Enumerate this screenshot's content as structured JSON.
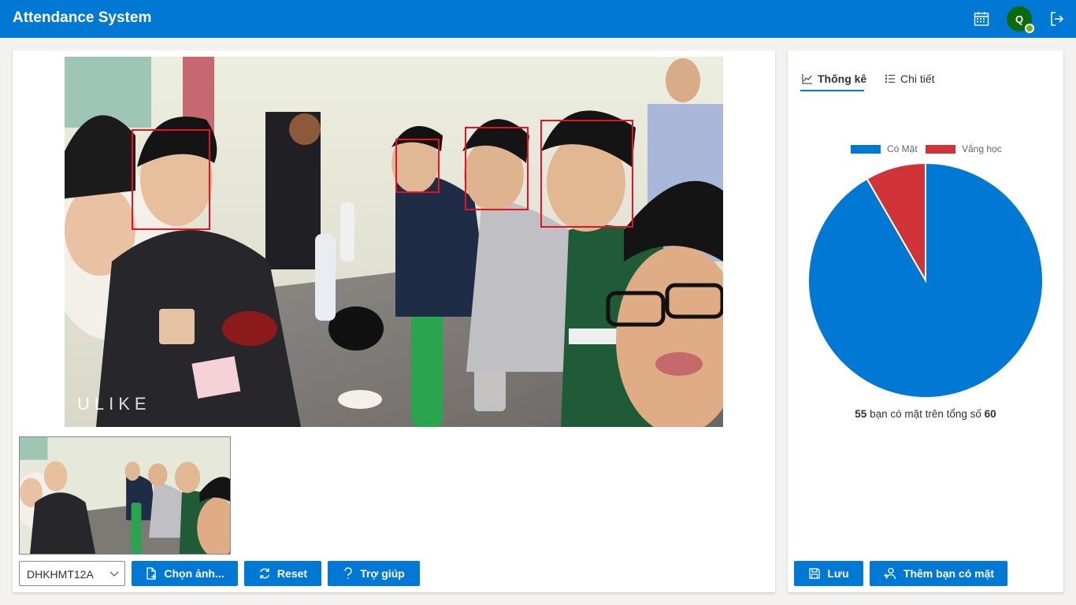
{
  "header": {
    "title": "Attendance System",
    "avatar_initial": "Q",
    "calendar_icon": "calendar-icon",
    "logout_icon": "sign-out-icon"
  },
  "controls": {
    "class_select": "DHKHMT12A",
    "choose_image_label": "Chọn ảnh...",
    "reset_label": "Reset",
    "help_label": "Trợ giúp",
    "watermark": "ULIKE"
  },
  "tabs": [
    {
      "label": "Thống kê",
      "icon": "line-chart-icon",
      "active": true
    },
    {
      "label": "Chi tiết",
      "icon": "bulleted-list-icon",
      "active": false
    }
  ],
  "chart_data": {
    "type": "pie",
    "labels": [
      "Có Mặt",
      "Vắng học"
    ],
    "values": [
      55,
      5
    ],
    "colors": [
      "#0078d4",
      "#d13438"
    ],
    "legend_position": "top"
  },
  "summary": {
    "present": "55",
    "middle": " bạn có mặt trên tổng số ",
    "total": "60"
  },
  "actions": {
    "save_label": "Lưu",
    "add_present_label": "Thêm bạn có mặt"
  },
  "colors": {
    "accent": "#0078d4",
    "absent": "#d13438",
    "face_box": "#e81123"
  }
}
